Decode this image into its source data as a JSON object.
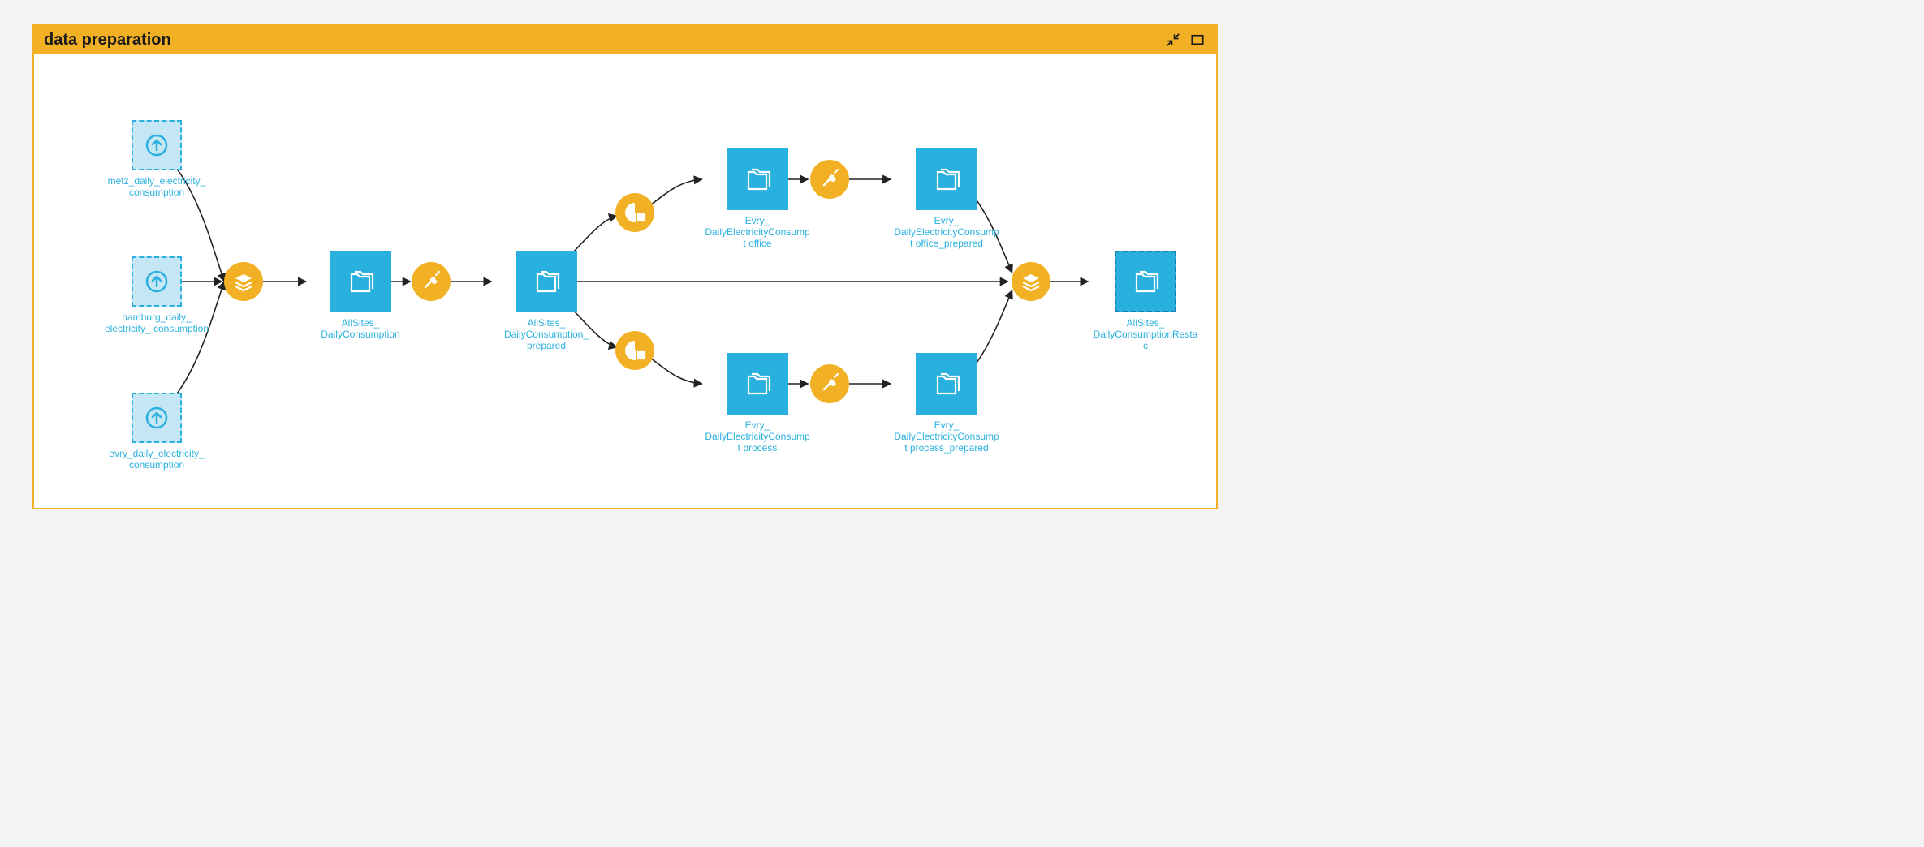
{
  "zone": {
    "title": "data preparation"
  },
  "colors": {
    "accent": "#f2b124",
    "dataset": "#2ab0de",
    "input_bg": "#c5e6f4",
    "page_bg": "#f3f3f3"
  },
  "nodes": {
    "metz": {
      "label": "metz_daily_electricity_ consumption"
    },
    "hamburg": {
      "label": "hamburg_daily_ electricity_ consumption"
    },
    "evry_in": {
      "label": "evry_daily_electricity_ consumption"
    },
    "allsites_daily": {
      "label": "AllSites_ DailyConsumption"
    },
    "allsites_prepared": {
      "label": "AllSites_ DailyConsumption_ prepared"
    },
    "evry_office": {
      "label": "Evry_ DailyElectricityConsumpt office"
    },
    "evry_office_prep": {
      "label": "Evry_ DailyElectricityConsumpt office_prepared"
    },
    "evry_process": {
      "label": "Evry_ DailyElectricityConsumpt process"
    },
    "evry_process_prep": {
      "label": "Evry_ DailyElectricityConsumpt process_prepared"
    },
    "allsites_restac": {
      "label": "AllSites_ DailyConsumptionRestac"
    }
  },
  "recipes": {
    "stack1": {
      "type": "stack"
    },
    "prep1": {
      "type": "prepare"
    },
    "split_office": {
      "type": "split"
    },
    "split_process": {
      "type": "split"
    },
    "prep_office": {
      "type": "prepare"
    },
    "prep_process": {
      "type": "prepare"
    },
    "stack2": {
      "type": "stack"
    }
  }
}
